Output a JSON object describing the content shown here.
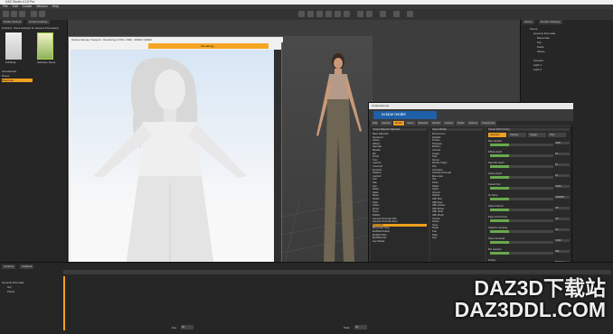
{
  "app": {
    "title": "DAZ Studio 4.15 Pro"
  },
  "window_controls": {
    "minimize": "—",
    "maximize": "□",
    "close": "✕"
  },
  "menu": [
    "File",
    "Edit",
    "Create",
    "Window",
    "Help"
  ],
  "left_panel": {
    "tabs": [
      "Smart Content",
      "Content Library"
    ],
    "path": "Products : Mona Hairstyle for Genesis 8 Female(s)",
    "thumbs": [
      "Full Body",
      "Hairstyle | Mona"
    ],
    "tree": [
      "Accessories",
      "Poses",
      "Wardrobe"
    ]
  },
  "render_window": {
    "title": "Octane Render Viewport : Rendering (1700 × 900) : 00000 / 00000",
    "status": "Rendering..."
  },
  "octane": {
    "header": "OctaneRender",
    "logo": "octane render",
    "tabs": [
      "Help",
      "Settings",
      "Render",
      "Scene",
      "Materials",
      "Render",
      "Camera",
      "Nodes",
      "Textures",
      "Postprocess"
    ],
    "left_header": "Octane Material: Materials",
    "left_rows": [
      "Basic Materials",
      "Rendered",
      "Glossy",
      "Diffuse",
      "Specular",
      "Metallic",
      "Mix",
      "Portal",
      "Toon",
      "Layered",
      "Universal",
      "Emissive",
      "Shadow",
      "Lambert",
      "Null",
      "Skin",
      "Hair",
      "Water",
      "Glass",
      "Metal",
      "Plastic",
      "Paint",
      "Fabric",
      "Wood",
      "Stone",
      "Rubber",
      "Genesis 8 Female Skin",
      "Genesis 8 Female Eyes",
      "Mona Hair",
      "Mona Hair Caps",
      "Modified Default",
      "Modified Skin",
      "Modified Hair",
      "Iray Default"
    ],
    "mid_header": "Scene Builder",
    "mid_rows": [
      "Environment",
      "Daylight",
      "Texture",
      "Planetary",
      "Medium",
      "Camera",
      "Imager",
      "Post",
      "Kernel",
      "Render Target",
      "Film",
      "Animation",
      "Genesis 8 Female",
      "Mona Hair",
      "Top",
      "Pants",
      "Shoes",
      "Lights",
      "Ground",
      "Default",
      "G8F Skin",
      "G8F Eyes",
      "G8F Lashes",
      "G8F Brows",
      "G8F Teeth",
      "G8F Mouth",
      "Cornea",
      "Sclera",
      "Irises",
      "Pupils",
      "Tear",
      "Nails",
      "Lips"
    ],
    "right_header": "Kernel: Path Tracing",
    "right_tabs": [
      "Standard",
      "Camera",
      "Imager",
      "Post"
    ],
    "right_rows": [
      "Max samples",
      "Diffuse depth",
      "Specular depth",
      "Glossy depth",
      "Caustic blur",
      "GI clamp",
      "Alpha channel",
      "Keep environment",
      "Adaptive sampling",
      "Noise threshold",
      "Min samples",
      "Priority"
    ],
    "values": [
      "1000",
      "16",
      "16",
      "24",
      "0.000",
      "1000000",
      "Off",
      "Off",
      "On",
      "0.020",
      "256",
      "Normal"
    ]
  },
  "scene_panel": {
    "tabs": [
      "Scene",
      "Render Settings"
    ],
    "nodes": [
      "Scene",
      "Genesis 8 Female",
      "Mona Hair",
      "Top",
      "Pants",
      "Shoes",
      "Camera",
      "Light 1",
      "Light 2"
    ]
  },
  "timeline": {
    "tabs": [
      "Timeline",
      "Aniblock"
    ],
    "rows": [
      "Genesis 8 Female",
      "Hip",
      "Pelvis"
    ],
    "labels": [
      "Play",
      "Loop",
      "Fps",
      "Total"
    ],
    "fps": "30",
    "total": "30"
  },
  "watermark": {
    "line1": "DAZ3D下载站",
    "line2": "DAZ3DDL.COM"
  }
}
